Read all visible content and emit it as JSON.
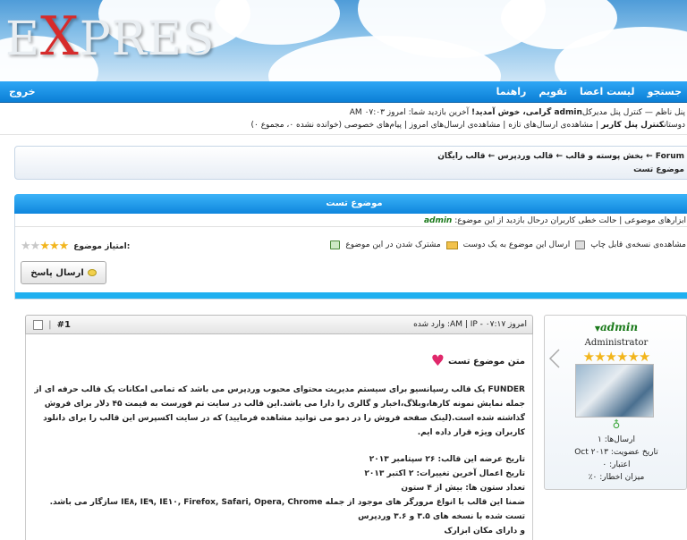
{
  "logo": {
    "prefix": "E",
    "x": "X",
    "rest": "PRES"
  },
  "nav": {
    "logout": "خروج",
    "links": [
      "جستجو",
      "لیست اعضا",
      "تقویم",
      "راهنما"
    ]
  },
  "welcome": {
    "line1_prefix": "پنل ناظم — کنترل پنل مدیرکل",
    "user": "admin",
    "line1_greet": " گرامی، خوش آمدید!",
    "line1_last": " آخرین بازدید شما: امروز ۰۷:۰۳ AM",
    "line2_prefix": "دوستان",
    "line2_cp": "کنترل پنل کاربر",
    "line2_rest": " | مشاهده‌ی ارسال‌های تازه | مشاهده‌ی ارسال‌های امروز | پیام‌های خصوصی (خوانده نشده ۰، مجموع ۰)"
  },
  "breadcrumb": {
    "path": "Forum ← بخش پوسته و قالب ← قالب وردپرس ← قالب رایگان",
    "current": "موضوع تست"
  },
  "thread": {
    "title": "موضوع تست",
    "tools_line": "ابزارهای موضوعی | حالت خطی کاربران درحال بازدید از این موضوع: ",
    "viewer": "admin",
    "print": "مشاهده‌ی نسخه‌ی قابل چاپ",
    "send": "ارسال این موضوع به یک دوست",
    "subscribe": "مشترک شدن در این موضوع",
    "rating_label": "امتیاز موضوع:",
    "rating_value": 3,
    "rating_max": 5,
    "reply": "ارسال پاسخ"
  },
  "post": {
    "number": "#1",
    "time": "امروز ۰۷:۱۷ - AM | IP: وارد شده",
    "title": "متن موضوع تست",
    "paragraphs": [
      "FUNDER یک قالب رسپانسیو برای سیستم مدیریت محتوای محبوب وردپرس می باشد که تمامی امکانات یک قالب حرفه ای از جمله نمایش نمونه کارها،وبلاگ،اخبار و گالری را دارا می باشد.این قالب در سایت تم فورست به قیمت ۴۵ دلار برای فروش گذاشته شده است.(لینک صفحه فروش را در دمو می توانید مشاهده فرمایید) که در سایت اکسپرس این قالب را برای دانلود کاربران ویژه قرار داده ایم.",
      "",
      "تاریخ عرضه این قالب: ۲۶ سپتامبر ۲۰۱۳",
      "تاریخ اعمال آخرین تغییرات: ۲ اکتبر ۲۰۱۳",
      "تعداد ستون ها: بیش از ۴ ستون",
      "ضمنا این قالب با انواع مرورگر های موجود از جمله IE۸, IE۹, IE۱۰, Firefox, Safari, Opera, Chrome سازگار می باشد.",
      "تست شده با نسخه های ۳.۵ و ۳.۶ وردپرس",
      "و دارای مکان ابزارک"
    ]
  },
  "user": {
    "name": "admin",
    "role": "Administrator",
    "posts": "ارسال‌ها: ۱",
    "joined": "تاریخ عضویت: Oct ۲۰۱۳",
    "reputation": "اعتبار: ۰",
    "warning": "میزان اخطار: ۰٪"
  },
  "colors": {
    "nav": "#0b7fd6",
    "accent": "#1fb0f0",
    "admin": "#1b7a1b"
  }
}
